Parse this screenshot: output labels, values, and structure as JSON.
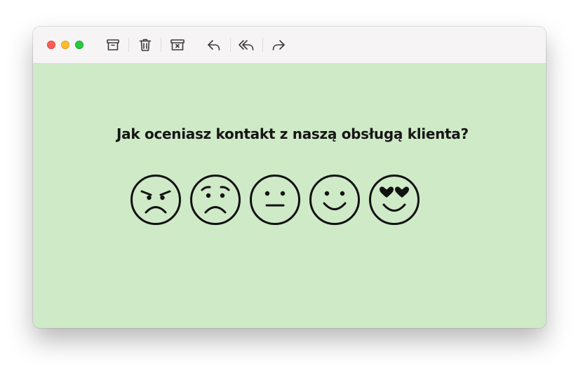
{
  "window": {
    "background_color": "#cfeac7",
    "toolbar_color": "#f6f4f5"
  },
  "toolbar": {
    "buttons": [
      {
        "icon": "archive-icon"
      },
      {
        "icon": "trash-icon"
      },
      {
        "icon": "junk-icon"
      },
      {
        "icon": "reply-icon"
      },
      {
        "icon": "reply-all-icon"
      },
      {
        "icon": "forward-icon"
      }
    ]
  },
  "survey": {
    "question": "Jak oceniasz kontakt z naszą obsługą klienta?",
    "ratings": [
      {
        "icon": "angry-face-icon"
      },
      {
        "icon": "sad-face-icon"
      },
      {
        "icon": "neutral-face-icon"
      },
      {
        "icon": "smiling-face-icon"
      },
      {
        "icon": "heart-eyes-face-icon"
      }
    ]
  }
}
